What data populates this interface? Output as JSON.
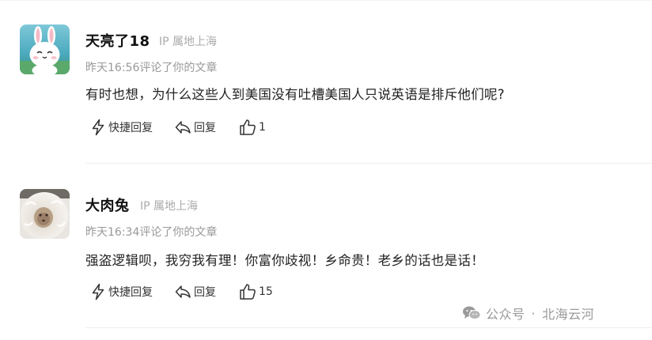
{
  "comments": [
    {
      "username": "天亮了18",
      "ip": "IP 属地上海",
      "meta": "昨天16:56评论了你的文章",
      "content": "有时也想，为什么这些人到美国没有吐槽美国人只说英语是排斥他们呢?",
      "actions": {
        "quick_reply": "快捷回复",
        "reply": "回复",
        "like_count": "1"
      },
      "avatar_icon": "bunny-avatar-icon"
    },
    {
      "username": "大肉兔",
      "ip": "IP 属地上海",
      "meta": "昨天16:34评论了你的文章",
      "content": "强盗逻辑呗，我穷我有理！你富你歧视！乡命贵！老乡的话也是话！",
      "actions": {
        "quick_reply": "快捷回复",
        "reply": "回复",
        "like_count": "15"
      },
      "avatar_icon": "fluffy-animal-avatar-icon"
    }
  ],
  "watermark": {
    "prefix": "公众号",
    "separator": "·",
    "name": "北海云河"
  },
  "colors": {
    "meta_text": "#999999",
    "ip_text": "#aaaaaa",
    "body_text": "#222222"
  }
}
